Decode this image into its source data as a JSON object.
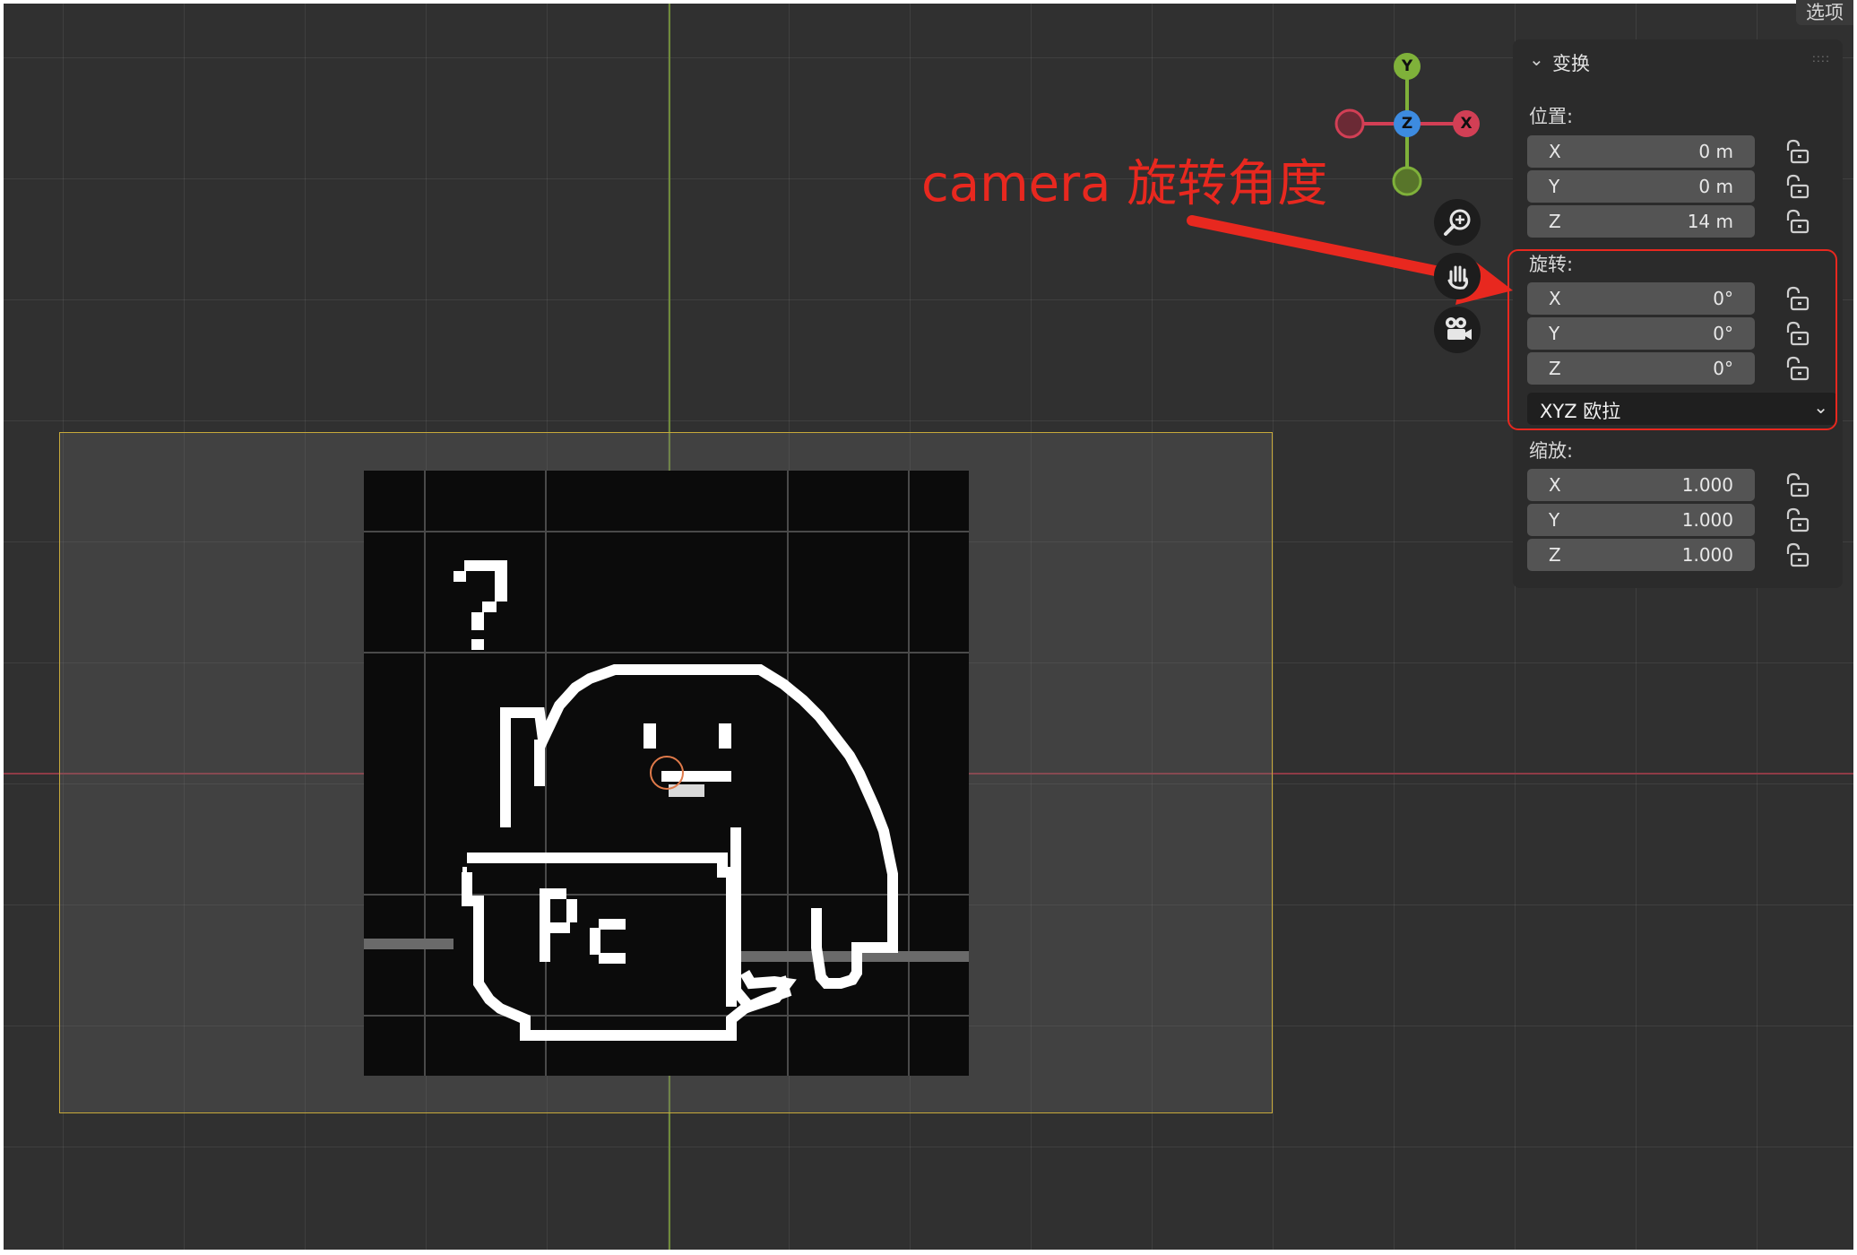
{
  "options_tab": "选项",
  "annotation": {
    "text": "camera 旋转角度"
  },
  "gizmo": {
    "y": "Y",
    "z": "Z",
    "x": "X"
  },
  "panel": {
    "title": "变换",
    "location": {
      "label": "位置:",
      "x": {
        "axis": "X",
        "value": "0 m"
      },
      "y": {
        "axis": "Y",
        "value": "0 m"
      },
      "z": {
        "axis": "Z",
        "value": "14 m"
      }
    },
    "rotation": {
      "label": "旋转:",
      "x": {
        "axis": "X",
        "value": "0°"
      },
      "y": {
        "axis": "Y",
        "value": "0°"
      },
      "z": {
        "axis": "Z",
        "value": "0°"
      },
      "mode": "XYZ 欧拉"
    },
    "scale": {
      "label": "缩放:",
      "x": {
        "axis": "X",
        "value": "1.000"
      },
      "y": {
        "axis": "Y",
        "value": "1.000"
      },
      "z": {
        "axis": "Z",
        "value": "1.000"
      }
    }
  },
  "image_text": {
    "question": "?",
    "cup": "Pc"
  },
  "colors": {
    "annotation": "#e8281f",
    "y_axis": "#7fb13a",
    "x_axis": "#d23f55",
    "z_axis": "#3d8be0",
    "camera_frame": "#c7a93a"
  }
}
